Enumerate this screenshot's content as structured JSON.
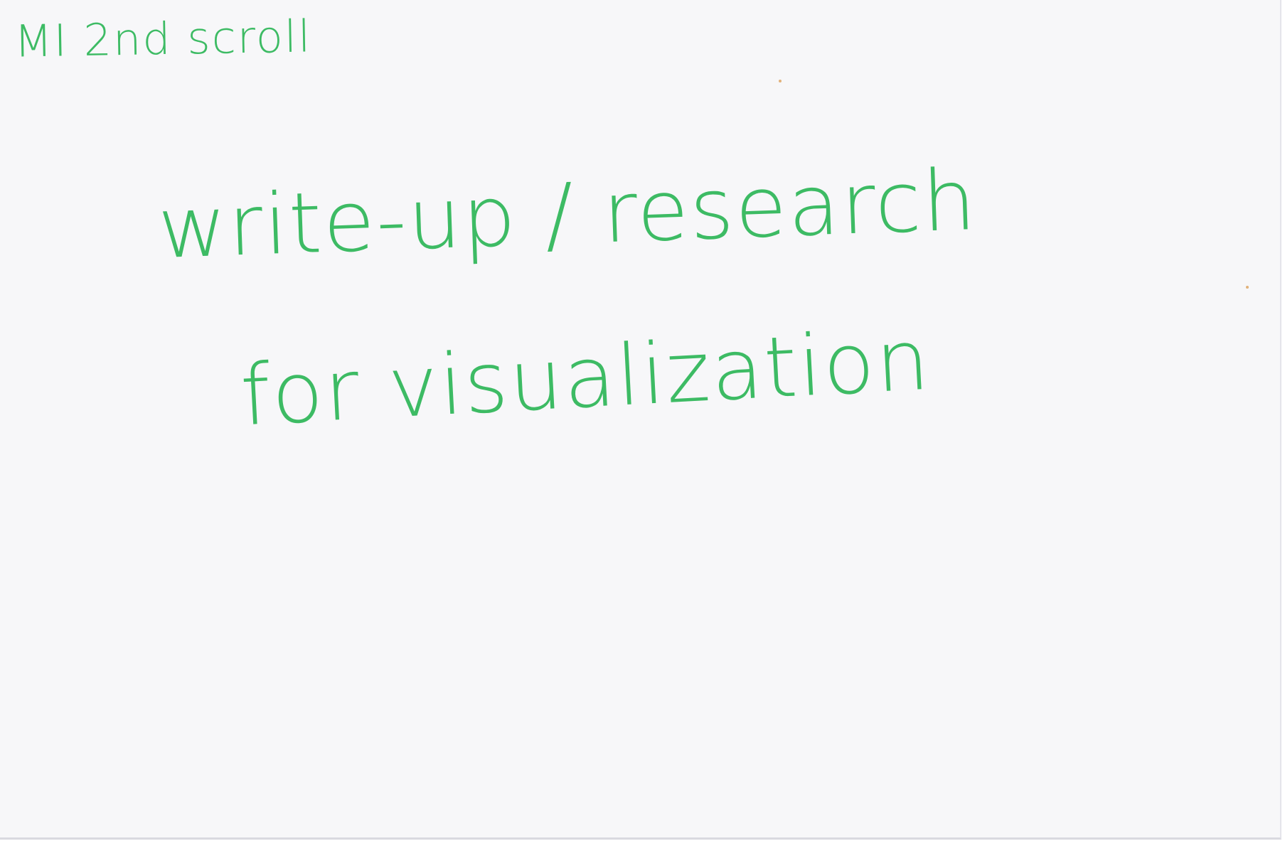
{
  "card": {
    "corner_label": "MI 2nd scroll",
    "lines": [
      "write-up / research",
      "for visualization"
    ]
  },
  "colors": {
    "ink": "#3dbb64",
    "paper": "#f7f7f9"
  }
}
